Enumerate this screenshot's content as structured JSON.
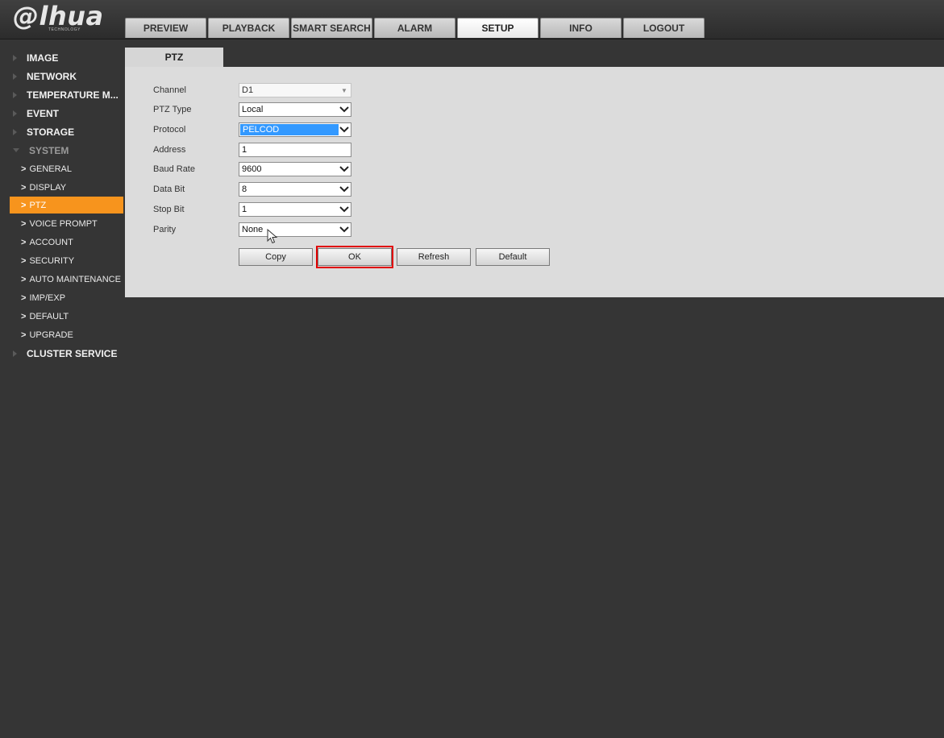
{
  "brand": {
    "logo": "@lhua",
    "sub": "TECHNOLOGY"
  },
  "nav": {
    "tabs": [
      "PREVIEW",
      "PLAYBACK",
      "SMART SEARCH",
      "ALARM",
      "SETUP",
      "INFO",
      "LOGOUT"
    ],
    "active": "SETUP"
  },
  "sidebar": {
    "top": [
      "IMAGE",
      "NETWORK",
      "TEMPERATURE M...",
      "EVENT",
      "STORAGE"
    ],
    "system_label": "SYSTEM",
    "system_items": [
      "GENERAL",
      "DISPLAY",
      "PTZ",
      "VOICE PROMPT",
      "ACCOUNT",
      "SECURITY",
      "AUTO MAINTENANCE",
      "IMP/EXP",
      "DEFAULT",
      "UPGRADE"
    ],
    "active_item": "PTZ",
    "bottom": "CLUSTER SERVICE"
  },
  "content": {
    "tab": "PTZ",
    "fields": {
      "channel": {
        "label": "Channel",
        "value": "D1"
      },
      "ptz_type": {
        "label": "PTZ Type",
        "value": "Local"
      },
      "protocol": {
        "label": "Protocol",
        "value": "PELCOD"
      },
      "address": {
        "label": "Address",
        "value": "1"
      },
      "baud_rate": {
        "label": "Baud Rate",
        "value": "9600"
      },
      "data_bit": {
        "label": "Data Bit",
        "value": "8"
      },
      "stop_bit": {
        "label": "Stop Bit",
        "value": "1"
      },
      "parity": {
        "label": "Parity",
        "value": "None"
      }
    },
    "buttons": {
      "copy": "Copy",
      "ok": "OK",
      "refresh": "Refresh",
      "default": "Default"
    }
  },
  "colors": {
    "active_orange": "#f7941d",
    "highlight_blue": "#3399ff",
    "outline_red": "#e00000"
  }
}
